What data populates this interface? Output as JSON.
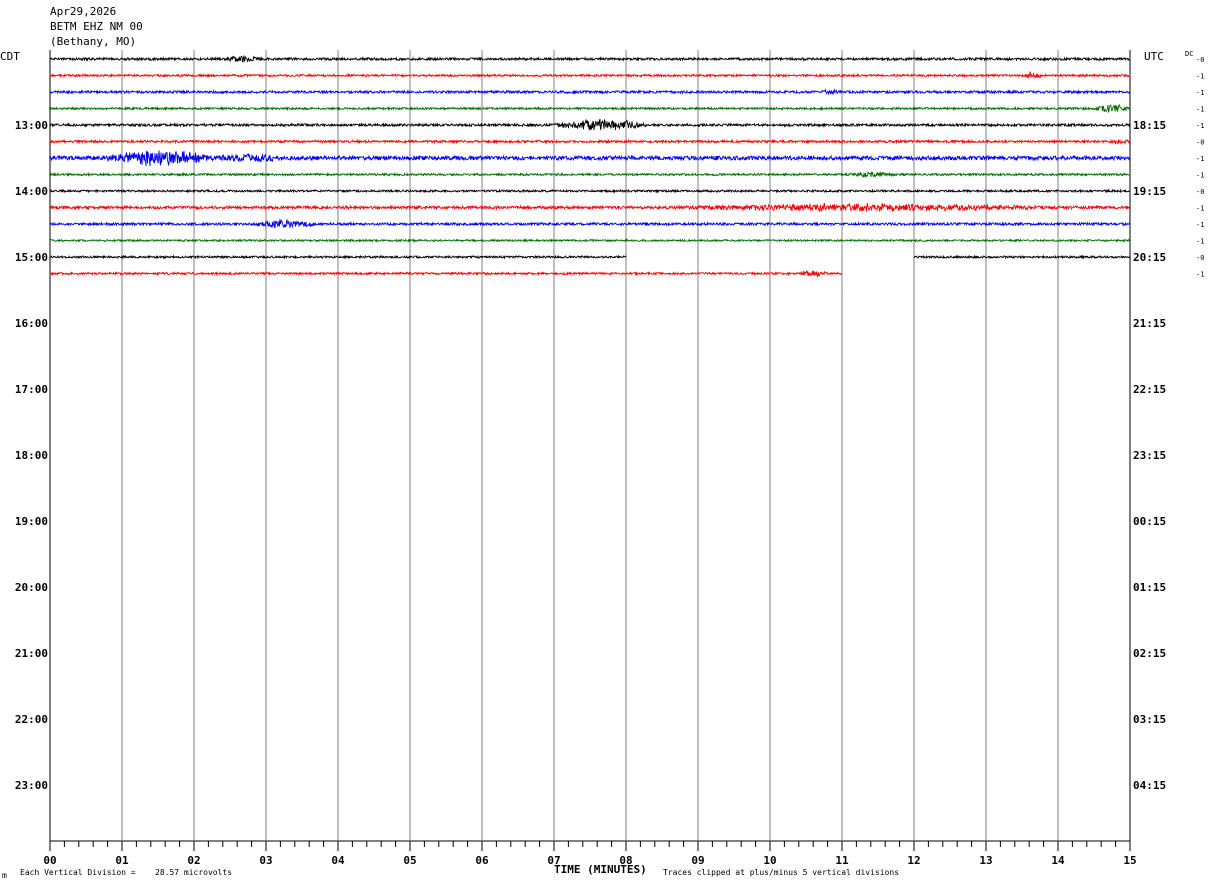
{
  "header": {
    "date": "Apr29,2026",
    "station": "BETM EHZ NM 00",
    "location": "(Bethany, MO)"
  },
  "chart_data": {
    "type": "helicorder",
    "left_axis_label": "CDT",
    "right_axis_label": "UTC",
    "dc_label": "DC",
    "xlabel": "TIME (MINUTES)",
    "x_ticks": [
      "00",
      "01",
      "02",
      "03",
      "04",
      "05",
      "06",
      "07",
      "08",
      "09",
      "10",
      "11",
      "12",
      "13",
      "14",
      "15"
    ],
    "xlim": [
      0,
      15
    ],
    "minutes_per_line": 15,
    "grid": true,
    "left_hour_labels": [
      "13:00",
      "14:00",
      "15:00",
      "16:00",
      "17:00",
      "18:00",
      "19:00",
      "20:00",
      "21:00",
      "22:00",
      "23:00"
    ],
    "right_hour_labels": [
      "18:15",
      "19:15",
      "20:15",
      "21:15",
      "22:15",
      "23:15",
      "00:15",
      "01:15",
      "02:15",
      "03:15",
      "04:15"
    ],
    "line_colors": [
      "#000000",
      "#ff0000",
      "#0000ff",
      "#007000"
    ],
    "traces": [
      {
        "dc": "-0",
        "segments": [
          [
            0,
            15
          ]
        ],
        "noise": 1.2,
        "events": [
          {
            "minute": 2.4,
            "amp": 3,
            "dur": 0.5
          }
        ]
      },
      {
        "dc": "-1",
        "segments": [
          [
            0,
            15
          ]
        ],
        "noise": 1.0,
        "events": [
          {
            "minute": 13.5,
            "amp": 3,
            "dur": 0.3
          }
        ]
      },
      {
        "dc": "-1",
        "segments": [
          [
            0,
            15
          ]
        ],
        "noise": 1.2,
        "events": [
          {
            "minute": 10.7,
            "amp": 2,
            "dur": 0.3
          }
        ]
      },
      {
        "dc": "-1",
        "segments": [
          [
            0,
            15
          ]
        ],
        "noise": 1.0,
        "events": [
          {
            "minute": 14.5,
            "amp": 4,
            "dur": 0.5
          }
        ]
      },
      {
        "dc": "-1",
        "segments": [
          [
            0,
            15
          ]
        ],
        "noise": 1.2,
        "events": [
          {
            "minute": 7.0,
            "amp": 6,
            "dur": 1.3
          }
        ]
      },
      {
        "dc": "-0",
        "segments": [
          [
            0,
            15
          ]
        ],
        "noise": 1.1,
        "events": [
          {
            "minute": 14.7,
            "amp": 2,
            "dur": 0.3
          }
        ]
      },
      {
        "dc": "-1",
        "segments": [
          [
            0,
            15
          ]
        ],
        "noise": 2.0,
        "events": [
          {
            "minute": 0.7,
            "amp": 7,
            "dur": 1.6
          },
          {
            "minute": 2.3,
            "amp": 3,
            "dur": 1.0
          }
        ]
      },
      {
        "dc": "-1",
        "segments": [
          [
            0,
            15
          ]
        ],
        "noise": 1.0,
        "events": [
          {
            "minute": 11.0,
            "amp": 2,
            "dur": 0.8
          }
        ]
      },
      {
        "dc": "-0",
        "segments": [
          [
            0,
            15
          ]
        ],
        "noise": 1.0,
        "events": []
      },
      {
        "dc": "-1",
        "segments": [
          [
            0,
            15
          ]
        ],
        "noise": 1.4,
        "events": [
          {
            "minute": 8.5,
            "amp": 3,
            "dur": 5.5
          }
        ]
      },
      {
        "dc": "-1",
        "segments": [
          [
            0,
            15
          ]
        ],
        "noise": 1.2,
        "events": [
          {
            "minute": 2.8,
            "amp": 4,
            "dur": 0.9
          }
        ]
      },
      {
        "dc": "-1",
        "segments": [
          [
            0,
            15
          ]
        ],
        "noise": 0.9,
        "events": []
      },
      {
        "dc": "-0",
        "segments": [
          [
            0,
            8.0
          ],
          [
            12.0,
            15
          ]
        ],
        "noise": 1.0,
        "events": []
      },
      {
        "dc": "-1",
        "segments": [
          [
            0,
            11.0
          ]
        ],
        "noise": 1.0,
        "events": [
          {
            "minute": 10.4,
            "amp": 3,
            "dur": 0.4
          }
        ]
      }
    ]
  },
  "footer": {
    "division_label": "Each Vertical Division =",
    "division_value": "28.57 microvolts",
    "clip_note": "Traces clipped at plus/minus 5 vertical divisions"
  }
}
